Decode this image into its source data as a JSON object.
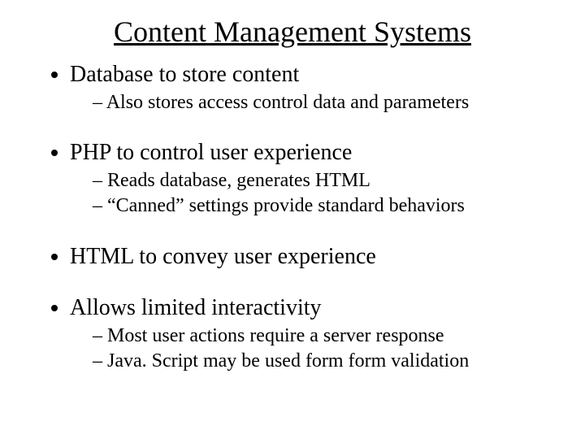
{
  "title": "Content Management Systems",
  "bullets": {
    "b1": {
      "text": "Database to store content",
      "sub": {
        "s1": "Also stores access control data and parameters"
      }
    },
    "b2": {
      "text": "PHP to control user experience",
      "sub": {
        "s1": "Reads database, generates HTML",
        "s2": "“Canned” settings provide standard behaviors"
      }
    },
    "b3": {
      "text": "HTML to convey user experience"
    },
    "b4": {
      "text": "Allows limited interactivity",
      "sub": {
        "s1": "Most user actions require a server response",
        "s2": "Java. Script may be used form form validation"
      }
    }
  }
}
